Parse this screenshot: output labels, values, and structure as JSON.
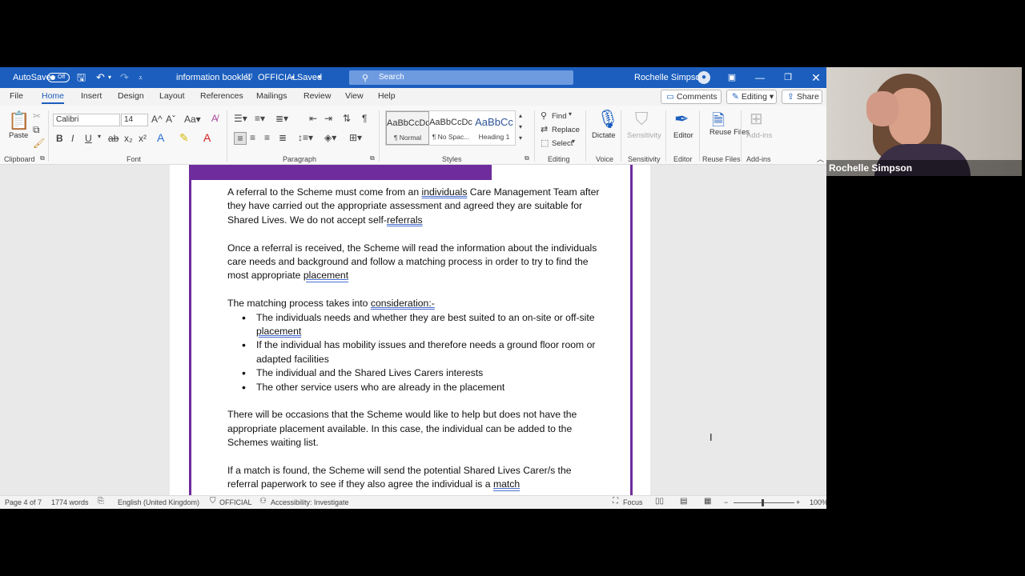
{
  "titlebar": {
    "autosave_label": "AutoSave",
    "autosave_state": "Off",
    "doc_title": "information booklet",
    "sensitivity": "OFFICIAL",
    "saved_state": "• Saved",
    "search_placeholder": "Search",
    "user_name": "Rochelle Simpson"
  },
  "menu": {
    "tabs": [
      "File",
      "Home",
      "Insert",
      "Design",
      "Layout",
      "References",
      "Mailings",
      "Review",
      "View",
      "Help"
    ],
    "active_tab": "Home",
    "comments": "Comments",
    "editing": "Editing",
    "share": "Share"
  },
  "ribbon": {
    "paste": "Paste",
    "font_name": "Calibri",
    "font_size": "14",
    "styles": [
      {
        "sample": "AaBbCcDc",
        "name": "¶ Normal"
      },
      {
        "sample": "AaBbCcDc",
        "name": "¶ No Spac..."
      },
      {
        "sample": "AaBbCc",
        "name": "Heading 1"
      }
    ],
    "find": "Find",
    "replace": "Replace",
    "select": "Select",
    "dictate": "Dictate",
    "sensitivity": "Sensitivity",
    "editor": "Editor",
    "reuse_files": "Reuse Files",
    "addins": "Add-ins",
    "groups": {
      "clipboard": "Clipboard",
      "font": "Font",
      "paragraph": "Paragraph",
      "styles": "Styles",
      "editing": "Editing",
      "voice": "Voice",
      "sensitivity": "Sensitivity",
      "editor": "Editor",
      "reuse_files": "Reuse Files",
      "addins": "Add-ins"
    }
  },
  "document": {
    "p1_a": "A referral to the Scheme must come from an ",
    "p1_u1": "individuals",
    "p1_b": " Care Management Team after they have carried out the appropriate assessment and agreed they are suitable for Shared Lives. We do not accept self-",
    "p1_u2": "referrals",
    "p2_a": "Once a referral is received, the Scheme will read the information about the individuals care needs and background and follow a matching process in order to try to find the most appropriate ",
    "p2_u": "placement",
    "p3_a": "The matching process takes into ",
    "p3_u": "consideration:-",
    "bullet1_a": "The individuals needs and whether they are best suited to an on-site or off-site ",
    "bullet1_u": "placement",
    "bullet2": "If the individual has mobility issues and therefore needs a ground floor room or adapted facilities",
    "bullet3": "The individual and the Shared Lives Carers interests",
    "bullet4": "The other service users who are already in the placement",
    "p4": "There will be occasions that the Scheme would like to help but does not have the appropriate placement available. In this case, the individual can be added to the Schemes waiting list.",
    "p5_a": "If a match is found, the Scheme will send the potential Shared Lives Carer/s the referral paperwork to see if they also agree the individual is a ",
    "p5_u": "match"
  },
  "status": {
    "page": "Page 4 of 7",
    "words": "1774 words",
    "language": "English (United Kingdom)",
    "sensitivity": "OFFICIAL",
    "accessibility": "Accessibility: Investigate",
    "focus": "Focus",
    "zoom": "100%"
  },
  "webcam": {
    "participant_name": "Rochelle Simpson"
  }
}
